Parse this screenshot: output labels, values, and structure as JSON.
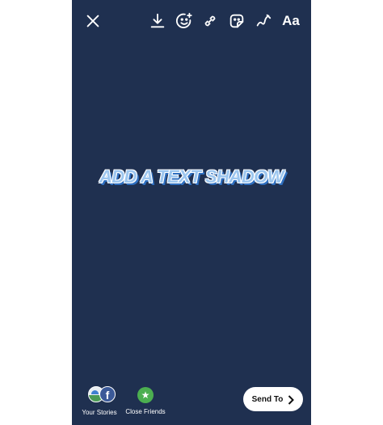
{
  "story": {
    "background_color": "#1f3050",
    "headline": "ADD A TEXT SHADOW",
    "headline_color": "#9cc6ef",
    "shadow_color": "#2e6fc0"
  },
  "toolbar": {
    "icons": [
      "close-icon",
      "download-icon",
      "face-effects-icon",
      "link-icon",
      "sticker-icon",
      "draw-icon",
      "text-icon"
    ],
    "text_tool_label": "Aa"
  },
  "bottom": {
    "your_stories_label": "Your Stories",
    "close_friends_label": "Close Friends",
    "facebook_glyph": "f",
    "close_friends_glyph": "★",
    "send_label": "Send To"
  }
}
